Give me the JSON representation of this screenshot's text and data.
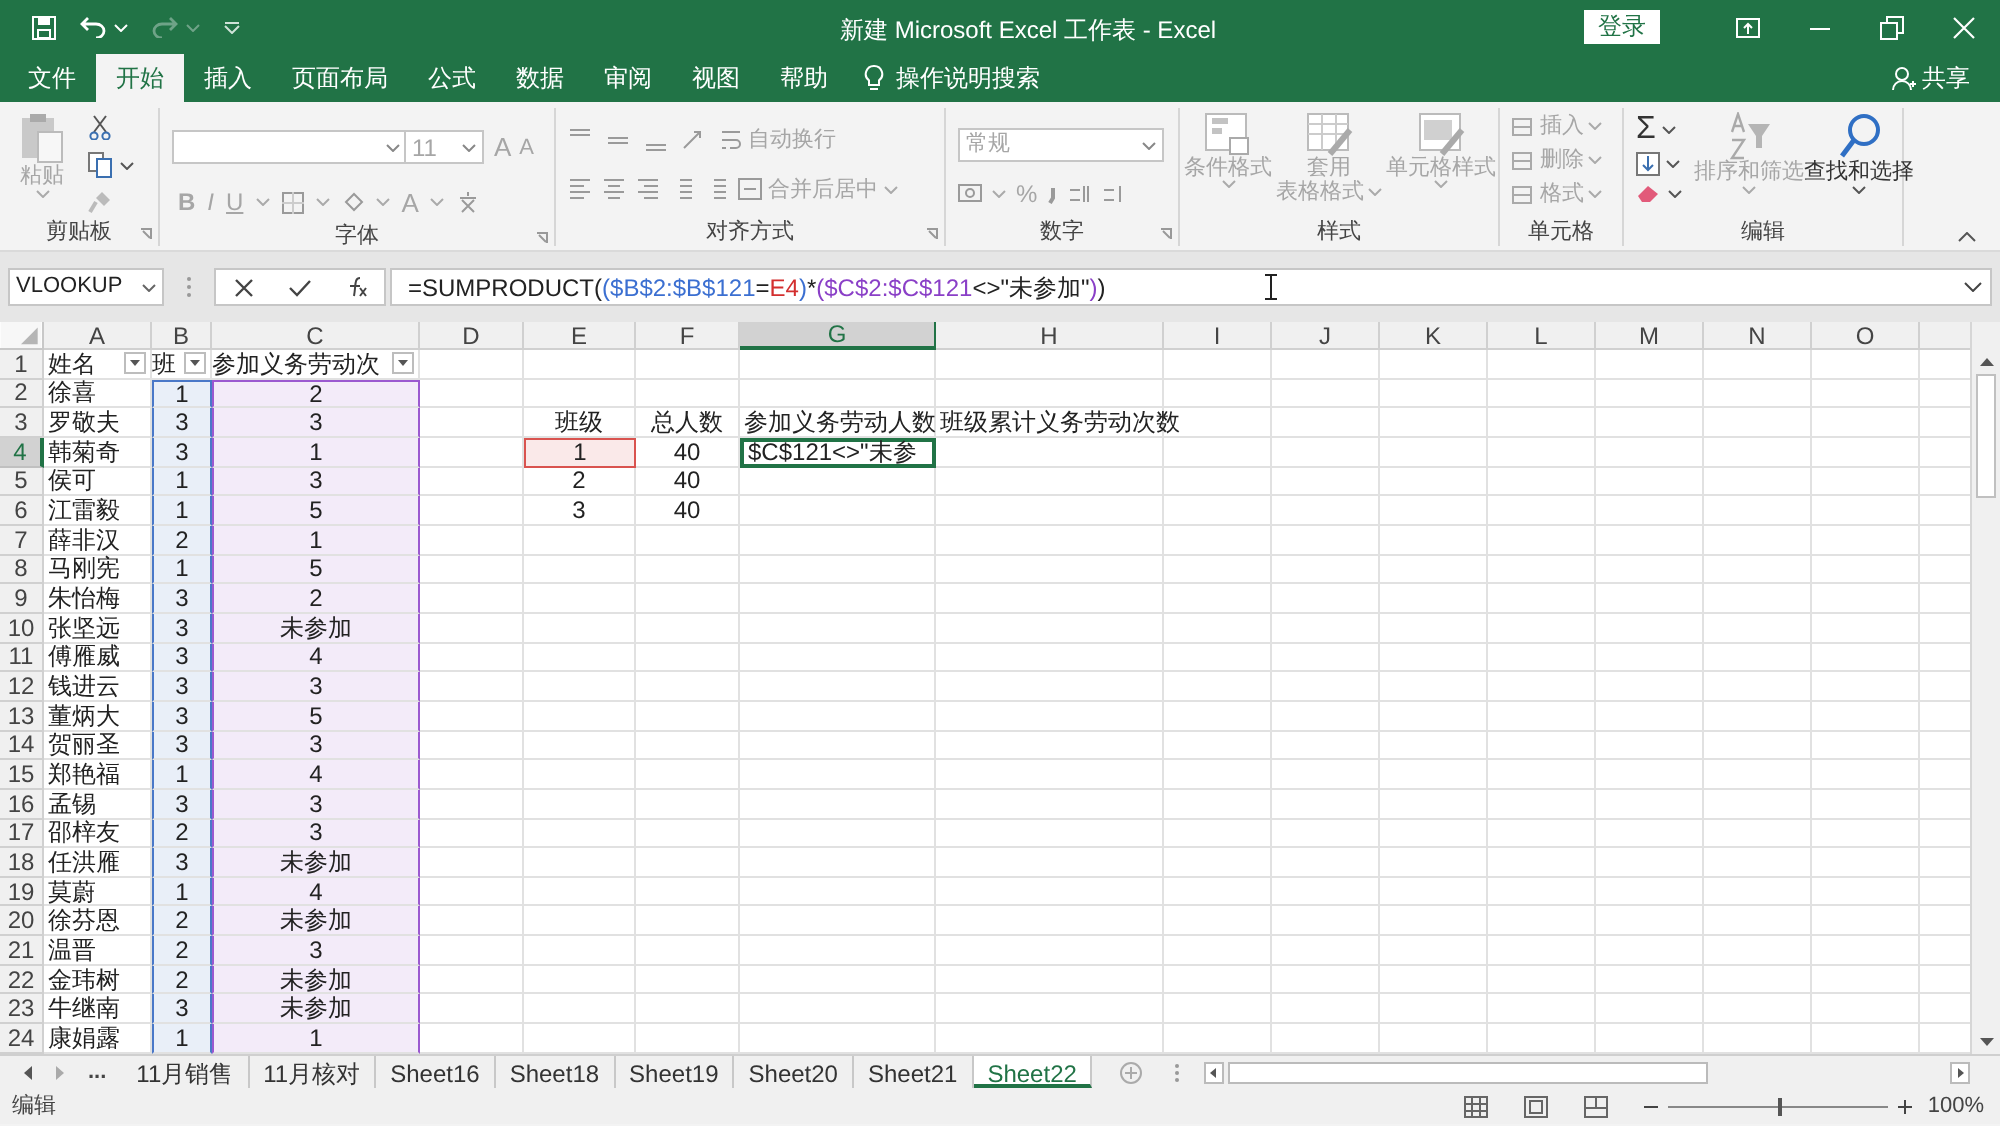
{
  "title_bar": {
    "title": "新建 Microsoft Excel 工作表  -  Excel",
    "sign_in": "登录"
  },
  "ribbon_tabs": [
    {
      "label": "文件",
      "selected": false
    },
    {
      "label": "开始",
      "selected": true
    },
    {
      "label": "插入",
      "selected": false
    },
    {
      "label": "页面布局",
      "selected": false
    },
    {
      "label": "公式",
      "selected": false
    },
    {
      "label": "数据",
      "selected": false
    },
    {
      "label": "审阅",
      "selected": false
    },
    {
      "label": "视图",
      "selected": false
    },
    {
      "label": "帮助",
      "selected": false
    }
  ],
  "tell_me": "操作说明搜索",
  "share": "共享",
  "ribbon": {
    "clipboard": {
      "label": "剪贴板",
      "paste": {
        "label": "粘贴",
        "disabled": true
      }
    },
    "font": {
      "label": "字体",
      "size": "11",
      "grow": "A",
      "shrink": "A",
      "bold": "B",
      "italic": "I",
      "underline": "U",
      "font_color": "A",
      "disabled": true
    },
    "alignment": {
      "label": "对齐方式",
      "wrap": {
        "label": "自动换行",
        "disabled": true
      },
      "merge": {
        "label": "合并后居中",
        "disabled": true
      }
    },
    "number": {
      "label": "数字",
      "format": "常规",
      "percent": "%",
      "disabled": true
    },
    "styles": {
      "label": "样式",
      "buttons": [
        {
          "lines": [
            "条件格式"
          ],
          "disabled": true
        },
        {
          "lines": [
            "套用",
            "表格格式"
          ],
          "disabled": true
        },
        {
          "lines": [
            "单元格样式"
          ],
          "disabled": true
        }
      ]
    },
    "cells": {
      "label": "单元格",
      "buttons": [
        {
          "label": "插入",
          "disabled": true
        },
        {
          "label": "删除",
          "disabled": true
        },
        {
          "label": "格式",
          "disabled": true
        }
      ]
    },
    "editing": {
      "label": "编辑",
      "sum": "Σ",
      "sort": {
        "label": "排序和筛选",
        "disabled": true
      },
      "find": {
        "label": "查找和选择",
        "disabled": false
      }
    }
  },
  "formula_bar": {
    "name_box": "VLOOKUP",
    "parts": [
      {
        "text": "=SUMPRODUCT(",
        "color": "#222222"
      },
      {
        "text": "(",
        "color": "#3b6fd1"
      },
      {
        "text": "$B$2:$B$121",
        "color": "#3b6fd1"
      },
      {
        "text": "=",
        "color": "#222222"
      },
      {
        "text": "E4",
        "color": "#d32f2f"
      },
      {
        "text": ")",
        "color": "#3b6fd1"
      },
      {
        "text": "*",
        "color": "#222222"
      },
      {
        "text": "(",
        "color": "#8a3fc7"
      },
      {
        "text": "$C$2:$C$121",
        "color": "#8a3fc7"
      },
      {
        "text": "<>\"未参加\"",
        "color": "#222222"
      },
      {
        "text": ")",
        "color": "#8a3fc7"
      },
      {
        "text": ")",
        "color": "#222222"
      }
    ]
  },
  "columns": [
    {
      "label": "A",
      "selected": false,
      "filter": true
    },
    {
      "label": "B",
      "selected": false,
      "filter": true,
      "color": "#4a78c8"
    },
    {
      "label": "C",
      "selected": false,
      "filter": true,
      "color": "#9b59d0"
    },
    {
      "label": "D",
      "selected": false,
      "filter": false
    },
    {
      "label": "E",
      "selected": false,
      "filter": false
    },
    {
      "label": "F",
      "selected": false,
      "filter": false
    },
    {
      "label": "G",
      "selected": true,
      "filter": false
    },
    {
      "label": "H",
      "selected": false,
      "filter": false
    },
    {
      "label": "I",
      "selected": false,
      "filter": false
    },
    {
      "label": "J",
      "selected": false,
      "filter": false
    },
    {
      "label": "K",
      "selected": false,
      "filter": false
    },
    {
      "label": "L",
      "selected": false,
      "filter": false
    },
    {
      "label": "M",
      "selected": false,
      "filter": false
    },
    {
      "label": "N",
      "selected": false,
      "filter": false
    },
    {
      "label": "O",
      "selected": false,
      "filter": false
    }
  ],
  "rows": [
    {
      "number": "1",
      "selected": false,
      "cells": {
        "A": "姓名",
        "B": "班",
        "C": "参加义务劳动次"
      }
    },
    {
      "number": "2",
      "selected": false,
      "cells": {
        "A": "徐喜",
        "B": "1",
        "C": "2"
      }
    },
    {
      "number": "3",
      "selected": false,
      "cells": {
        "A": "罗敬夫",
        "B": "3",
        "C": "3",
        "E": "班级",
        "F": "总人数",
        "G": "参加义务劳动人数",
        "H": "班级累计义务劳动次数"
      }
    },
    {
      "number": "4",
      "selected": true,
      "cells": {
        "A": "韩菊奇",
        "B": "3",
        "C": "1",
        "E": {
          "text": "1",
          "color": "#d9534f"
        },
        "F": "40",
        "G": {
          "text": "$C$121<>\"未参",
          "editing": true
        }
      }
    },
    {
      "number": "5",
      "selected": false,
      "cells": {
        "A": "侯可",
        "B": "1",
        "C": "3",
        "E": "2",
        "F": "40"
      }
    },
    {
      "number": "6",
      "selected": false,
      "cells": {
        "A": "江雷毅",
        "B": "1",
        "C": "5",
        "E": "3",
        "F": "40"
      }
    },
    {
      "number": "7",
      "selected": false,
      "cells": {
        "A": "薛非汉",
        "B": "2",
        "C": "1"
      }
    },
    {
      "number": "8",
      "selected": false,
      "cells": {
        "A": "马刚宪",
        "B": "1",
        "C": "5"
      }
    },
    {
      "number": "9",
      "selected": false,
      "cells": {
        "A": "朱怡梅",
        "B": "3",
        "C": "2"
      }
    },
    {
      "number": "10",
      "selected": false,
      "cells": {
        "A": "张坚远",
        "B": "3",
        "C": "未参加"
      }
    },
    {
      "number": "11",
      "selected": false,
      "cells": {
        "A": "傅雁威",
        "B": "3",
        "C": "4"
      }
    },
    {
      "number": "12",
      "selected": false,
      "cells": {
        "A": "钱进云",
        "B": "3",
        "C": "3"
      }
    },
    {
      "number": "13",
      "selected": false,
      "cells": {
        "A": "董炳大",
        "B": "3",
        "C": "5"
      }
    },
    {
      "number": "14",
      "selected": false,
      "cells": {
        "A": "贺丽圣",
        "B": "3",
        "C": "3"
      }
    },
    {
      "number": "15",
      "selected": false,
      "cells": {
        "A": "郑艳福",
        "B": "1",
        "C": "4"
      }
    },
    {
      "number": "16",
      "selected": false,
      "cells": {
        "A": "孟锡",
        "B": "3",
        "C": "3"
      }
    },
    {
      "number": "17",
      "selected": false,
      "cells": {
        "A": "邵梓友",
        "B": "2",
        "C": "3"
      }
    },
    {
      "number": "18",
      "selected": false,
      "cells": {
        "A": "任洪雁",
        "B": "3",
        "C": "未参加"
      }
    },
    {
      "number": "19",
      "selected": false,
      "cells": {
        "A": "莫蔚",
        "B": "1",
        "C": "4"
      }
    },
    {
      "number": "20",
      "selected": false,
      "cells": {
        "A": "徐芬恩",
        "B": "2",
        "C": "未参加"
      }
    },
    {
      "number": "21",
      "selected": false,
      "cells": {
        "A": "温晋",
        "B": "2",
        "C": "3"
      }
    },
    {
      "number": "22",
      "selected": false,
      "cells": {
        "A": "金玮树",
        "B": "2",
        "C": "未参加"
      }
    },
    {
      "number": "23",
      "selected": false,
      "cells": {
        "A": "牛继南",
        "B": "3",
        "C": "未参加"
      }
    },
    {
      "number": "24",
      "selected": false,
      "cells": {
        "A": "康娟露",
        "B": "1",
        "C": "1"
      }
    }
  ],
  "sheet_nav": "...",
  "sheet_tabs": [
    {
      "label": "11月销售",
      "selected": false
    },
    {
      "label": "11月核对",
      "selected": false
    },
    {
      "label": "Sheet16",
      "selected": false
    },
    {
      "label": "Sheet18",
      "selected": false
    },
    {
      "label": "Sheet19",
      "selected": false
    },
    {
      "label": "Sheet20",
      "selected": false
    },
    {
      "label": "Sheet21",
      "selected": false
    },
    {
      "label": "Sheet22",
      "selected": true
    }
  ],
  "status_bar": {
    "mode": "编辑",
    "zoom": "100%",
    "zoom_slider": {
      "level": 0.5
    }
  }
}
